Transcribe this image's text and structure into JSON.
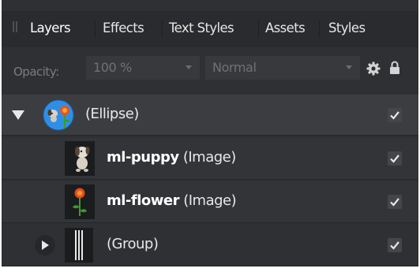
{
  "tabs": [
    {
      "label": "Layers",
      "active": true
    },
    {
      "label": "Effects",
      "active": false
    },
    {
      "label": "Text Styles",
      "active": false
    },
    {
      "label": "Assets",
      "active": false
    },
    {
      "label": "Styles",
      "active": false
    }
  ],
  "toolbar": {
    "opacity_label": "Opacity:",
    "opacity_value": "100 %",
    "blend_mode": "Normal",
    "settings_icon": "gear-icon",
    "lock_icon": "lock-icon"
  },
  "layers": [
    {
      "name": "",
      "type": "(Ellipse)",
      "expanded": true,
      "visible": true,
      "depth": 0
    },
    {
      "name": "ml-puppy",
      "type": "(Image)",
      "visible": true,
      "depth": 1
    },
    {
      "name": "ml-flower",
      "type": "(Image)",
      "visible": true,
      "depth": 1
    },
    {
      "name": "",
      "type": "(Group)",
      "expanded": false,
      "visible": true,
      "depth": 1
    }
  ],
  "colors": {
    "panel_bg": "#2f3033",
    "selected_row": "#3c3d41",
    "text": "#e8e8e8"
  }
}
